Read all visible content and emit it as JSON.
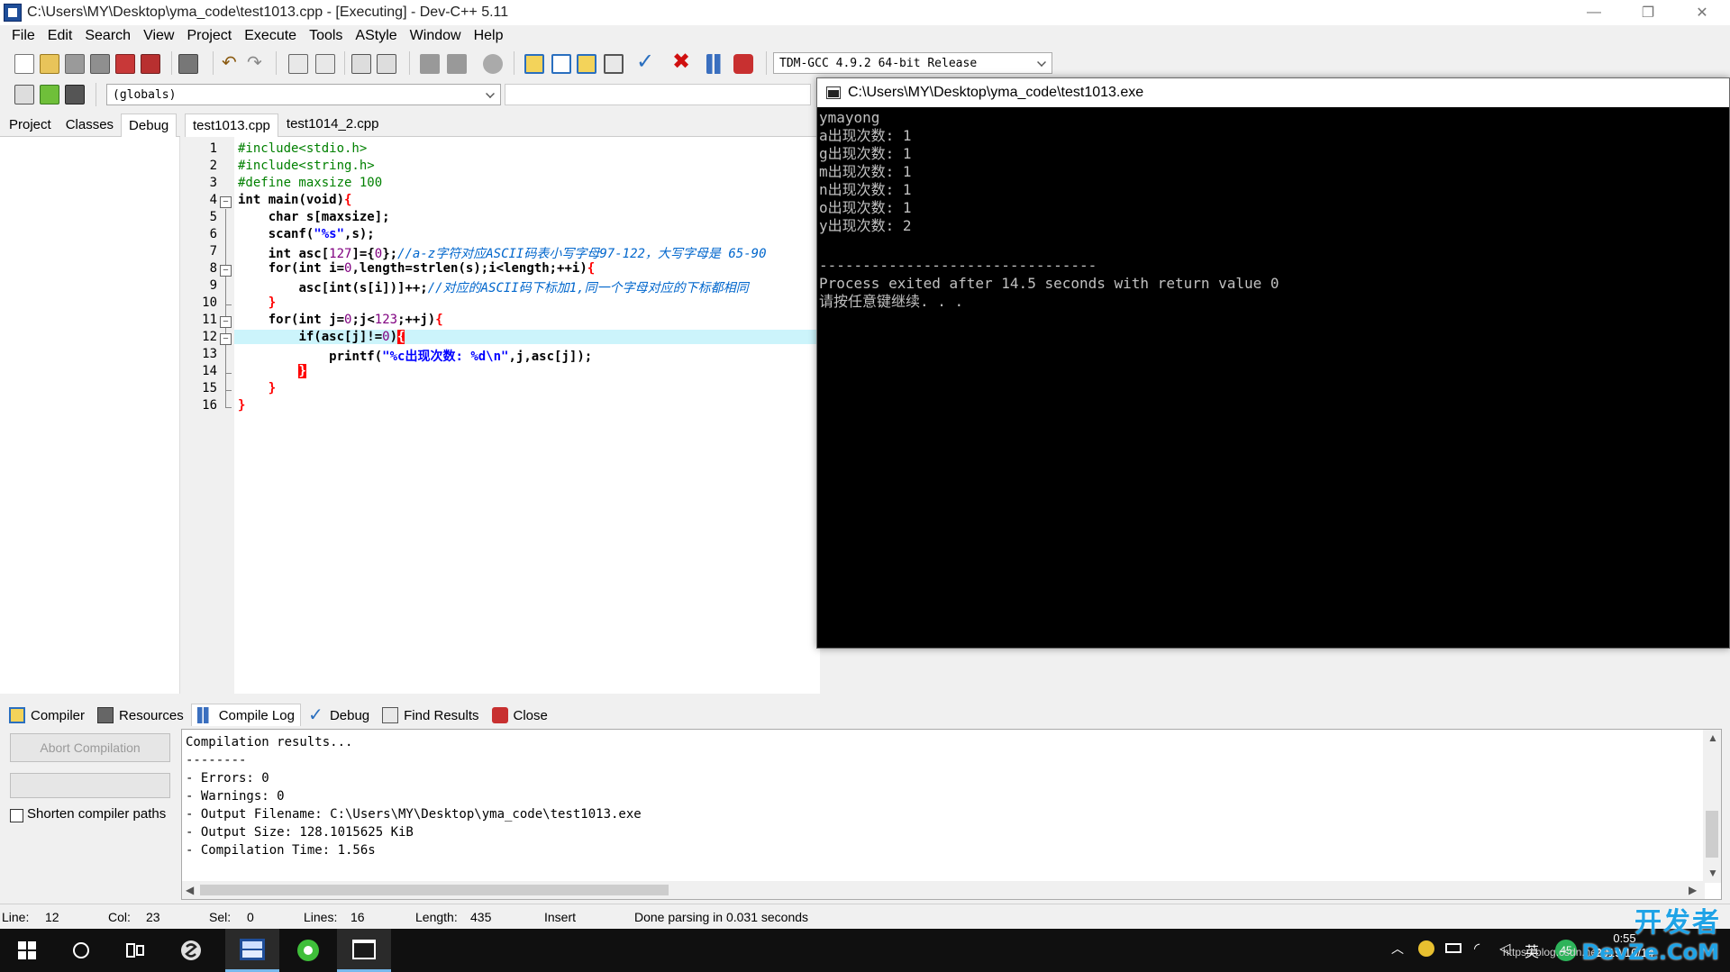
{
  "window": {
    "title": "C:\\Users\\MY\\Desktop\\yma_code\\test1013.cpp - [Executing] - Dev-C++ 5.11",
    "minimize": "—",
    "restore": "❐",
    "close": "✕"
  },
  "menu": [
    "File",
    "Edit",
    "Search",
    "View",
    "Project",
    "Execute",
    "Tools",
    "AStyle",
    "Window",
    "Help"
  ],
  "toolbar": {
    "compiler_combo": "TDM-GCC 4.9.2 64-bit Release",
    "scope_combo": "(globals)"
  },
  "left_tabs": [
    "Project",
    "Classes",
    "Debug"
  ],
  "editor_tabs": [
    "test1013.cpp",
    "test1014_2.cpp"
  ],
  "editor": {
    "line_numbers": [
      "1",
      "2",
      "3",
      "4",
      "5",
      "6",
      "7",
      "8",
      "9",
      "10",
      "11",
      "12",
      "13",
      "14",
      "15",
      "16"
    ],
    "current_line": 12,
    "code": {
      "l1": "#include<stdio.h>",
      "l2": "#include<string.h>",
      "l3": "#define maxsize 100",
      "l4_kw": "int",
      "l4_rest": " main(void)",
      "l4_brace": "{",
      "l5_kw": "char",
      "l5_rest": " s[maxsize];",
      "l6_a": "scanf(",
      "l6_str": "\"%s\"",
      "l6_b": ",s);",
      "l7_kw": "int",
      "l7_a": " asc[",
      "l7_n1": "127",
      "l7_b": "]={",
      "l7_n2": "0",
      "l7_c": "};",
      "l7_cmt": "//a-z字符对应ASCII码表小写字母97-122，大写字母是 65-90",
      "l8_kw": "for",
      "l8_a": "(",
      "l8_kw2": "int",
      "l8_b": " i=",
      "l8_n": "0",
      "l8_c": ",length=strlen(s);i<length;++i)",
      "l8_brace": "{",
      "l9_a": "asc[",
      "l9_kw": "int",
      "l9_b": "(s[i])]++;",
      "l9_cmt": "//对应的ASCII码下标加1,同一个字母对应的下标都相同",
      "l10_brace": "}",
      "l11_kw": "for",
      "l11_a": "(",
      "l11_kw2": "int",
      "l11_b": " j=",
      "l11_n1": "0",
      "l11_c": ";j<",
      "l11_n2": "123",
      "l11_d": ";++j)",
      "l11_brace": "{",
      "l12_kw": "if",
      "l12_a": "(asc[j]!=",
      "l12_n": "0",
      "l12_b": ")",
      "l12_brace": "{",
      "l13_a": "printf(",
      "l13_str": "\"%c出现次数: %d\\n\"",
      "l13_b": ",j,asc[j]);",
      "l14_brace": "}",
      "l15_brace": "}",
      "l16_brace": "}"
    }
  },
  "console": {
    "title": "C:\\Users\\MY\\Desktop\\yma_code\\test1013.exe",
    "lines": [
      "ymayong",
      "a出现次数: 1",
      "g出现次数: 1",
      "m出现次数: 1",
      "n出现次数: 1",
      "o出现次数: 1",
      "y出现次数: 2",
      "",
      "--------------------------------",
      "Process exited after 14.5 seconds with return value 0",
      "请按任意键继续. . ."
    ]
  },
  "bottom_tabs": [
    "Compiler",
    "Resources",
    "Compile Log",
    "Debug",
    "Find Results",
    "Close"
  ],
  "bottom_left": {
    "abort_label": "Abort Compilation",
    "shorten_label": "Shorten compiler paths"
  },
  "compile_log": [
    "Compilation results...",
    "--------",
    "- Errors: 0",
    "- Warnings: 0",
    "- Output Filename: C:\\Users\\MY\\Desktop\\yma_code\\test1013.exe",
    "- Output Size: 128.1015625 KiB",
    "- Compilation Time: 1.56s"
  ],
  "status": {
    "line_label": "Line:",
    "line_value": "12",
    "col_label": "Col:",
    "col_value": "23",
    "sel_label": "Sel:",
    "sel_value": "0",
    "lines_label": "Lines:",
    "lines_value": "16",
    "length_label": "Length:",
    "length_value": "435",
    "mode": "Insert",
    "message": "Done parsing in 0.031 seconds"
  },
  "taskbar": {
    "time": "0:55",
    "date": "2019/10/14",
    "ime": "英",
    "badge": "45",
    "url": "https://blog.csdn.net"
  },
  "watermark": {
    "cn": "开发者",
    "en": "DevZe.CoM"
  }
}
